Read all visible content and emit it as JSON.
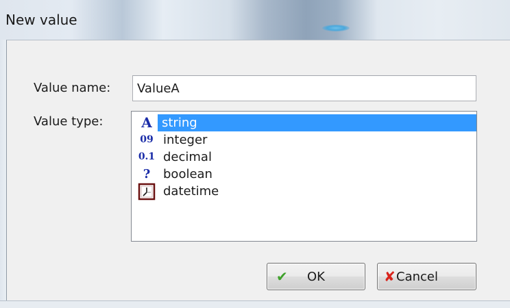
{
  "window": {
    "title": "New value"
  },
  "form": {
    "name_label": "Value name:",
    "name_value": "ValueA",
    "type_label": "Value type:"
  },
  "type_list": {
    "selected": "string",
    "items": [
      {
        "icon": "A",
        "label": "string"
      },
      {
        "icon": "09",
        "label": "integer"
      },
      {
        "icon": "0.1",
        "label": "decimal"
      },
      {
        "icon": "?",
        "label": "boolean"
      },
      {
        "icon": "datetime-icon",
        "label": "datetime"
      }
    ]
  },
  "buttons": {
    "ok_label": "OK",
    "cancel_label": "Cancel"
  },
  "colors": {
    "selection": "#3399ff",
    "icon_text": "#1a2ca8",
    "ok_check": "#3fa12b",
    "cancel_x": "#d8241c"
  }
}
